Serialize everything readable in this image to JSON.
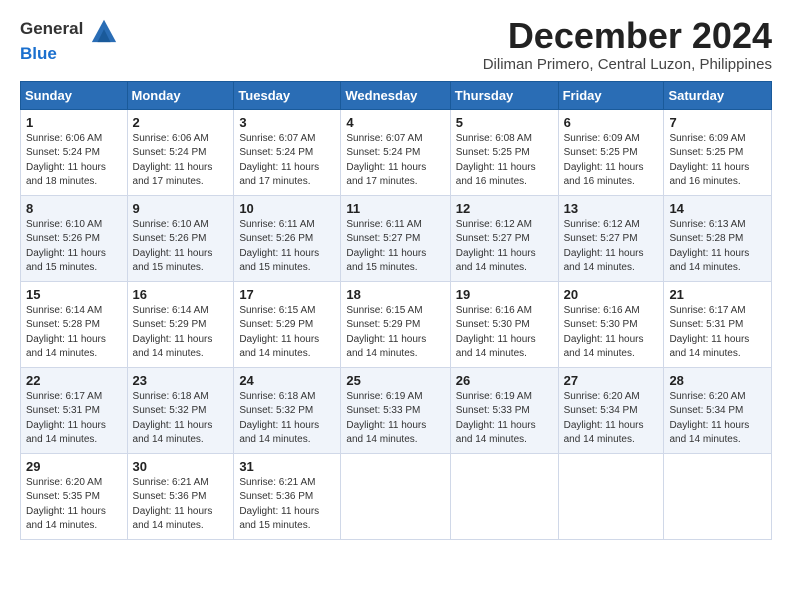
{
  "header": {
    "logo_general": "General",
    "logo_blue": "Blue",
    "month_title": "December 2024",
    "location": "Diliman Primero, Central Luzon, Philippines"
  },
  "days_of_week": [
    "Sunday",
    "Monday",
    "Tuesday",
    "Wednesday",
    "Thursday",
    "Friday",
    "Saturday"
  ],
  "weeks": [
    [
      {
        "day": "1",
        "sunrise": "6:06 AM",
        "sunset": "5:24 PM",
        "daylight": "11 hours and 18 minutes."
      },
      {
        "day": "2",
        "sunrise": "6:06 AM",
        "sunset": "5:24 PM",
        "daylight": "11 hours and 17 minutes."
      },
      {
        "day": "3",
        "sunrise": "6:07 AM",
        "sunset": "5:24 PM",
        "daylight": "11 hours and 17 minutes."
      },
      {
        "day": "4",
        "sunrise": "6:07 AM",
        "sunset": "5:24 PM",
        "daylight": "11 hours and 17 minutes."
      },
      {
        "day": "5",
        "sunrise": "6:08 AM",
        "sunset": "5:25 PM",
        "daylight": "11 hours and 16 minutes."
      },
      {
        "day": "6",
        "sunrise": "6:09 AM",
        "sunset": "5:25 PM",
        "daylight": "11 hours and 16 minutes."
      },
      {
        "day": "7",
        "sunrise": "6:09 AM",
        "sunset": "5:25 PM",
        "daylight": "11 hours and 16 minutes."
      }
    ],
    [
      {
        "day": "8",
        "sunrise": "6:10 AM",
        "sunset": "5:26 PM",
        "daylight": "11 hours and 15 minutes."
      },
      {
        "day": "9",
        "sunrise": "6:10 AM",
        "sunset": "5:26 PM",
        "daylight": "11 hours and 15 minutes."
      },
      {
        "day": "10",
        "sunrise": "6:11 AM",
        "sunset": "5:26 PM",
        "daylight": "11 hours and 15 minutes."
      },
      {
        "day": "11",
        "sunrise": "6:11 AM",
        "sunset": "5:27 PM",
        "daylight": "11 hours and 15 minutes."
      },
      {
        "day": "12",
        "sunrise": "6:12 AM",
        "sunset": "5:27 PM",
        "daylight": "11 hours and 14 minutes."
      },
      {
        "day": "13",
        "sunrise": "6:12 AM",
        "sunset": "5:27 PM",
        "daylight": "11 hours and 14 minutes."
      },
      {
        "day": "14",
        "sunrise": "6:13 AM",
        "sunset": "5:28 PM",
        "daylight": "11 hours and 14 minutes."
      }
    ],
    [
      {
        "day": "15",
        "sunrise": "6:14 AM",
        "sunset": "5:28 PM",
        "daylight": "11 hours and 14 minutes."
      },
      {
        "day": "16",
        "sunrise": "6:14 AM",
        "sunset": "5:29 PM",
        "daylight": "11 hours and 14 minutes."
      },
      {
        "day": "17",
        "sunrise": "6:15 AM",
        "sunset": "5:29 PM",
        "daylight": "11 hours and 14 minutes."
      },
      {
        "day": "18",
        "sunrise": "6:15 AM",
        "sunset": "5:29 PM",
        "daylight": "11 hours and 14 minutes."
      },
      {
        "day": "19",
        "sunrise": "6:16 AM",
        "sunset": "5:30 PM",
        "daylight": "11 hours and 14 minutes."
      },
      {
        "day": "20",
        "sunrise": "6:16 AM",
        "sunset": "5:30 PM",
        "daylight": "11 hours and 14 minutes."
      },
      {
        "day": "21",
        "sunrise": "6:17 AM",
        "sunset": "5:31 PM",
        "daylight": "11 hours and 14 minutes."
      }
    ],
    [
      {
        "day": "22",
        "sunrise": "6:17 AM",
        "sunset": "5:31 PM",
        "daylight": "11 hours and 14 minutes."
      },
      {
        "day": "23",
        "sunrise": "6:18 AM",
        "sunset": "5:32 PM",
        "daylight": "11 hours and 14 minutes."
      },
      {
        "day": "24",
        "sunrise": "6:18 AM",
        "sunset": "5:32 PM",
        "daylight": "11 hours and 14 minutes."
      },
      {
        "day": "25",
        "sunrise": "6:19 AM",
        "sunset": "5:33 PM",
        "daylight": "11 hours and 14 minutes."
      },
      {
        "day": "26",
        "sunrise": "6:19 AM",
        "sunset": "5:33 PM",
        "daylight": "11 hours and 14 minutes."
      },
      {
        "day": "27",
        "sunrise": "6:20 AM",
        "sunset": "5:34 PM",
        "daylight": "11 hours and 14 minutes."
      },
      {
        "day": "28",
        "sunrise": "6:20 AM",
        "sunset": "5:34 PM",
        "daylight": "11 hours and 14 minutes."
      }
    ],
    [
      {
        "day": "29",
        "sunrise": "6:20 AM",
        "sunset": "5:35 PM",
        "daylight": "11 hours and 14 minutes."
      },
      {
        "day": "30",
        "sunrise": "6:21 AM",
        "sunset": "5:36 PM",
        "daylight": "11 hours and 14 minutes."
      },
      {
        "day": "31",
        "sunrise": "6:21 AM",
        "sunset": "5:36 PM",
        "daylight": "11 hours and 15 minutes."
      },
      null,
      null,
      null,
      null
    ]
  ]
}
